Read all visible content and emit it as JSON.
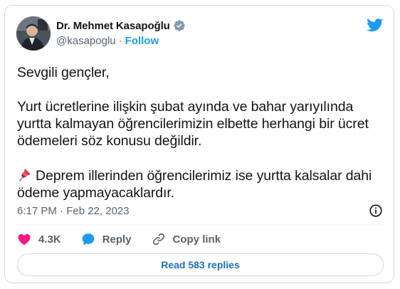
{
  "author": {
    "name": "Dr. Mehmet Kasapoğlu",
    "handle": "@kasapoglu",
    "separator": "·",
    "follow_label": "Follow"
  },
  "tweet": {
    "greeting": "Sevgili gençler,",
    "paragraph1": "Yurt ücretlerine ilişkin şubat ayında ve bahar yarıyılında yurtta kalmayan öğrencilerimizin elbette herhangi bir ücret ödemeleri söz konusu değildir.",
    "paragraph2": "Deprem illerinden öğrencilerimiz ise yurtta kalsalar dahi ödeme yapmayacaklardır.",
    "timestamp": "6:17 PM · Feb 22, 2023"
  },
  "actions": {
    "likes": "4.3K",
    "reply_label": "Reply",
    "copy_link_label": "Copy link"
  },
  "read_replies_label": "Read 583 replies",
  "colors": {
    "accent": "#1d9bf0",
    "heart": "#f91880",
    "text": "#0f1419",
    "muted": "#536471",
    "border": "#cfd9de"
  },
  "icons": {
    "avatar": "profile-photo",
    "verified": "verified-badge-icon",
    "brand": "twitter-bird-icon",
    "pin": "pushpin-emoji",
    "info": "info-icon",
    "like": "heart-icon",
    "reply": "speech-bubble-icon",
    "copy": "link-icon"
  }
}
